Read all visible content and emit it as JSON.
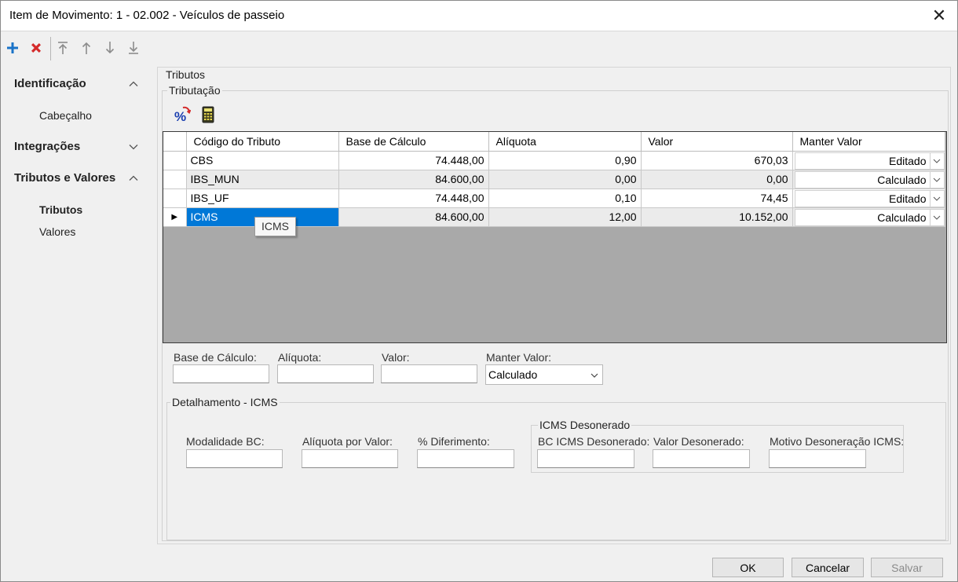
{
  "window": {
    "title": "Item de Movimento: 1 - 02.002 - Veículos de passeio"
  },
  "sidebar": {
    "sections": [
      {
        "label": "Identificação",
        "expanded": true,
        "items": [
          "Cabeçalho"
        ]
      },
      {
        "label": "Integrações",
        "expanded": false,
        "items": []
      },
      {
        "label": "Tributos e Valores",
        "expanded": true,
        "items": [
          "Tributos",
          "Valores"
        ]
      }
    ],
    "active_item": "Tributos"
  },
  "main": {
    "group_tributos": "Tributos",
    "group_tributacao": "Tributação",
    "grid": {
      "columns": [
        "Código do Tributo",
        "Base de Cálculo",
        "Alíquota",
        "Valor",
        "Manter Valor"
      ],
      "rows": [
        {
          "codigo": "CBS",
          "base": "74.448,00",
          "aliquota": "0,90",
          "valor": "670,03",
          "manter": "Editado"
        },
        {
          "codigo": "IBS_MUN",
          "base": "84.600,00",
          "aliquota": "0,00",
          "valor": "0,00",
          "manter": "Calculado"
        },
        {
          "codigo": "IBS_UF",
          "base": "74.448,00",
          "aliquota": "0,10",
          "valor": "74,45",
          "manter": "Editado"
        },
        {
          "codigo": "ICMS",
          "base": "84.600,00",
          "aliquota": "12,00",
          "valor": "10.152,00",
          "manter": "Calculado"
        }
      ],
      "selected_row": 3,
      "tooltip": "ICMS"
    },
    "edit": {
      "base_label": "Base de Cálculo:",
      "base_value": "",
      "aliquota_label": "Alíquota:",
      "aliquota_value": "",
      "valor_label": "Valor:",
      "valor_value": "",
      "manter_label": "Manter Valor:",
      "manter_value": "Calculado"
    },
    "detalhamento": {
      "legend": "Detalhamento - ICMS",
      "modalidade_label": "Modalidade BC:",
      "aliquota_valor_label": "Alíquota por Valor:",
      "diferimento_label": "% Diferimento:",
      "desonerado": {
        "legend": "ICMS Desonerado",
        "bc_label": "BC ICMS Desonerado:",
        "valor_label": "Valor Desonerado:",
        "motivo_label": "Motivo Desoneração ICMS:"
      }
    }
  },
  "footer": {
    "ok": "OK",
    "cancel": "Cancelar",
    "save": "Salvar"
  },
  "colors": {
    "accent_blue": "#0078d7",
    "delete_red": "#d42a2a",
    "add_blue": "#1a73c8",
    "grid_empty": "#a9a9a9"
  }
}
